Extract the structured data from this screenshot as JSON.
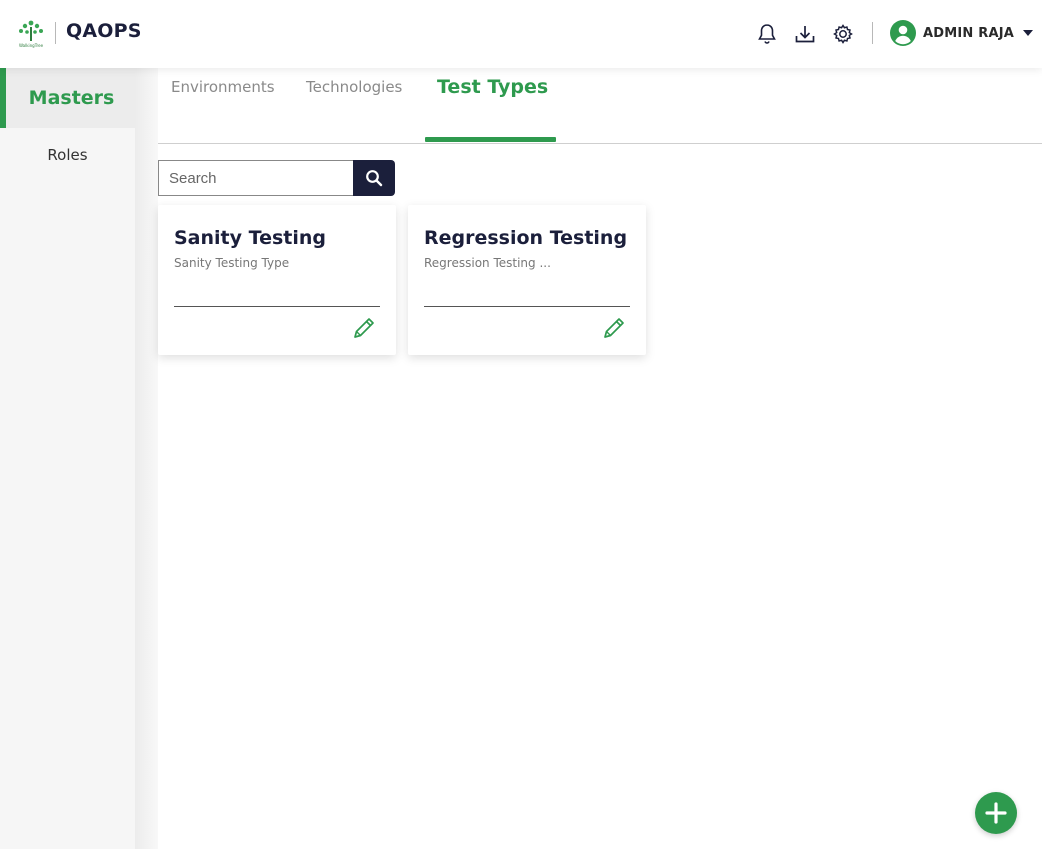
{
  "header": {
    "app_name": "QAOPS",
    "logo_icon": "tree-logo-icon",
    "icons": [
      "bell-icon",
      "download-icon",
      "settings-gear-icon"
    ],
    "user": {
      "name": "ADMIN RAJA",
      "avatar_icon": "user-circle-icon",
      "menu_icon": "caret-down-icon"
    }
  },
  "sidebar": {
    "items": [
      {
        "label": "Masters",
        "active": true
      },
      {
        "label": "Roles",
        "active": false
      }
    ]
  },
  "tabs": [
    {
      "label": "Environments",
      "active": false
    },
    {
      "label": "Technologies",
      "active": false
    },
    {
      "label": "Test Types",
      "active": true
    }
  ],
  "search": {
    "placeholder": "Search",
    "value": "",
    "icon": "search-icon"
  },
  "cards": [
    {
      "title": "Sanity Testing",
      "description": "Sanity Testing Type",
      "edit_icon": "pencil-edit-icon"
    },
    {
      "title": "Regression Testing",
      "description": "Regression Testing ...",
      "edit_icon": "pencil-edit-icon"
    }
  ],
  "fab": {
    "icon": "plus-icon"
  },
  "colors": {
    "accent": "#2e9a4e",
    "dark": "#1b1f3b",
    "sidebar_bg": "#f6f6f6"
  }
}
